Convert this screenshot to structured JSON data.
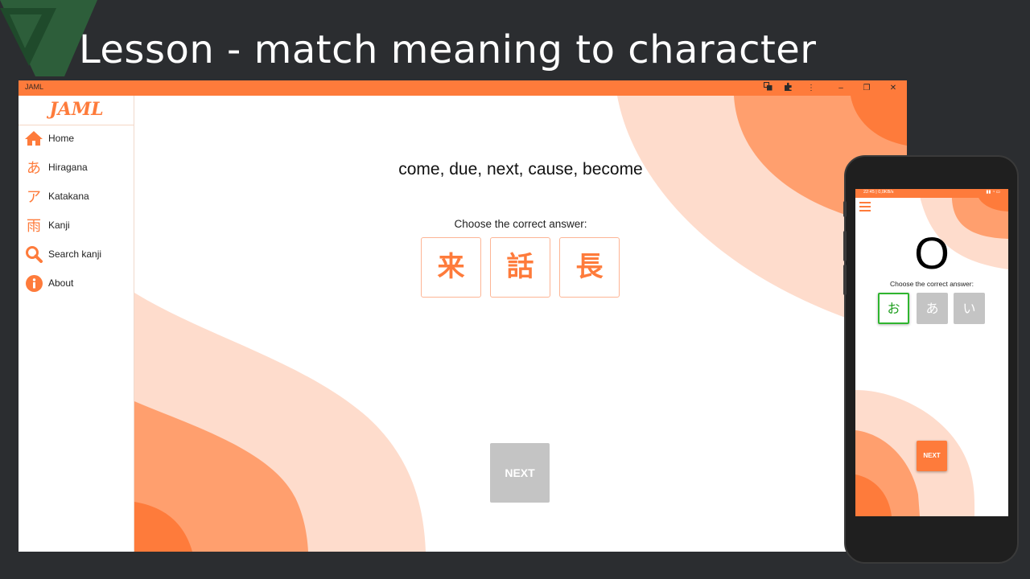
{
  "slide": {
    "title": "Lesson - match meaning to character"
  },
  "window": {
    "title": "JAML",
    "controls": {
      "minimize": "–",
      "restore": "❐",
      "close": "✕"
    }
  },
  "sidebar": {
    "logo": "JAML",
    "items": [
      {
        "label": "Home",
        "icon": "home-icon"
      },
      {
        "label": "Hiragana",
        "icon": "あ"
      },
      {
        "label": "Katakana",
        "icon": "ア"
      },
      {
        "label": "Kanji",
        "icon": "雨"
      },
      {
        "label": "Search kanji",
        "icon": "search-icon"
      },
      {
        "label": "About",
        "icon": "info-icon"
      }
    ]
  },
  "lesson": {
    "meaning": "come, due, next, cause, become",
    "instruction": "Choose the correct answer:",
    "options": [
      "来",
      "話",
      "長"
    ],
    "next_label": "NEXT",
    "next_enabled": false
  },
  "phone": {
    "status_time": "22:45 | 0,0KB/s",
    "character": "O",
    "instruction": "Choose the correct answer:",
    "options": [
      {
        "char": "お",
        "state": "correct"
      },
      {
        "char": "あ",
        "state": "disabled"
      },
      {
        "char": "い",
        "state": "disabled"
      }
    ],
    "next_label": "NEXT"
  },
  "colors": {
    "accent": "#fe7b3b",
    "accent_light": "#ff9f6e",
    "accent_pale": "#fedccc",
    "correct": "#2fb52f",
    "disabled": "#c4c4c4",
    "slide_bg": "#2b2d30"
  }
}
